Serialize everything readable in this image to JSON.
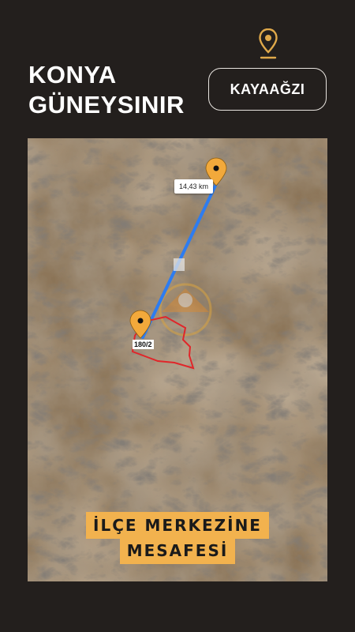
{
  "header": {
    "city_line1": "KONYA",
    "city_line2": "GÜNEYSINIR",
    "location_icon": "map-pin-icon",
    "village_button": "KAYAAĞZI"
  },
  "map": {
    "distance_label": "14,43 km",
    "parcel_label": "180/2",
    "route_color": "#2d7cf0",
    "parcel_outline_color": "#e0262a",
    "marker_color": "#f2a93b",
    "caption_line1": "İLÇE MERKEZİNE",
    "caption_line2": "MESAFESİ",
    "caption_bg": "#f2b24e"
  }
}
